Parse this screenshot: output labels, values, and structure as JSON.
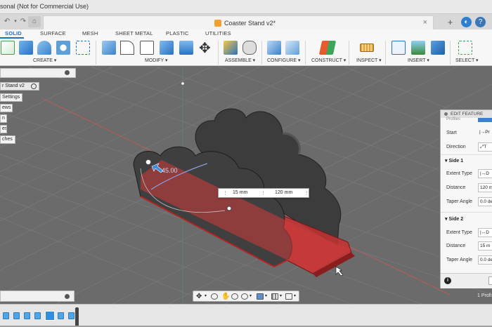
{
  "titlebar": {
    "app_title": "sonal (Not for Commercial Use)"
  },
  "tabs": {
    "doc_title": "Coaster Stand v2*",
    "close": "×",
    "new_tab": "+",
    "help": "?"
  },
  "toolbar": {
    "workspace_tabs": [
      "SOLID",
      "SURFACE",
      "MESH",
      "SHEET METAL",
      "PLASTIC",
      "UTILITIES"
    ],
    "groups": [
      "CREATE ▾",
      "MODIFY ▾",
      "ASSEMBLE ▾",
      "CONFIGURE ▾",
      "CONSTRUCT ▾",
      "INSPECT ▾",
      "INSERT ▾",
      "SELECT ▾"
    ]
  },
  "browser": {
    "items": [
      "r Stand v2",
      "Settings",
      "ews",
      "n",
      "es",
      "ches"
    ]
  },
  "viewport": {
    "angle_label": "45.00",
    "dim_distance_1": "15 mm",
    "dim_distance_2": "120 mm"
  },
  "feature_panel": {
    "title": "EDIT FEATURE",
    "profiles_label": "Profiles",
    "start_label": "Start",
    "start_value": "Pr",
    "direction_label": "Direction",
    "direction_value": "T",
    "side1_label": "Side 1",
    "side1_extent_type_label": "Extent Type",
    "side1_extent_value": "D",
    "side1_distance_label": "Distance",
    "side1_distance_value": "120 m",
    "side1_taper_label": "Taper Angle",
    "side1_taper_value": "0.0 de",
    "side2_label": "Side 2",
    "side2_extent_type_label": "Extent Type",
    "side2_extent_value": "D",
    "side2_distance_label": "Distance",
    "side2_distance_value": "15 m",
    "side2_taper_label": "Taper Angle",
    "side2_taper_value": "0.0 de",
    "info_icon": "i",
    "profile_count": "1 Profi"
  },
  "colors": {
    "accent": "#1a73c8",
    "body": "#3a3a3a",
    "extrude": "#c42a2a",
    "grid": "#7a7a7a"
  }
}
